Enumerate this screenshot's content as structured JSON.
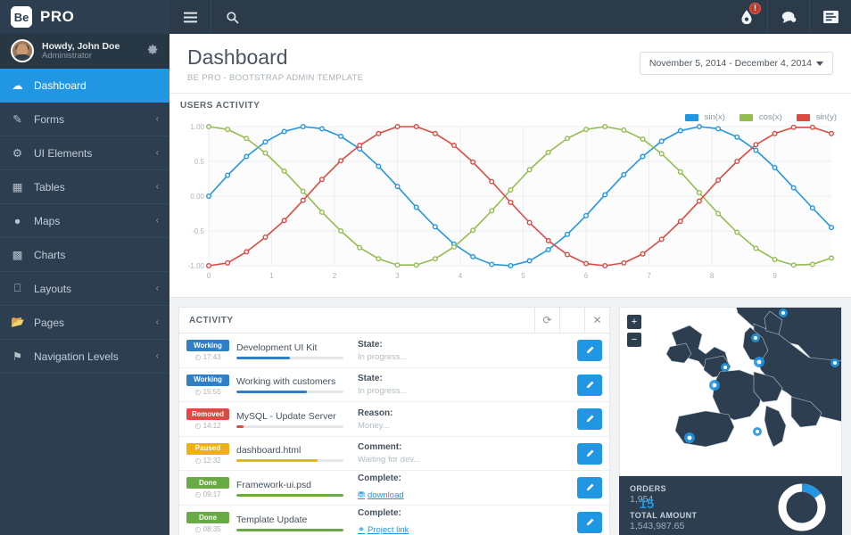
{
  "brand": {
    "mark": "Be",
    "name": "PRO"
  },
  "user": {
    "greeting": "Howdy, John Doe",
    "role": "Administrator",
    "settings_icon": "gear-icon"
  },
  "sidebar": {
    "items": [
      {
        "label": "Dashboard",
        "icon": "dashboard-icon",
        "active": true,
        "caret": ""
      },
      {
        "label": "Forms",
        "icon": "pencil-icon",
        "active": false,
        "caret": "‹"
      },
      {
        "label": "UI Elements",
        "icon": "ui-elements-icon",
        "active": false,
        "caret": "‹"
      },
      {
        "label": "Tables",
        "icon": "table-icon",
        "active": false,
        "caret": "‹"
      },
      {
        "label": "Maps",
        "icon": "map-pin-icon",
        "active": false,
        "caret": "‹"
      },
      {
        "label": "Charts",
        "icon": "bar-chart-icon",
        "active": false,
        "caret": ""
      },
      {
        "label": "Layouts",
        "icon": "monitor-icon",
        "active": false,
        "caret": "‹"
      },
      {
        "label": "Pages",
        "icon": "folder-icon",
        "active": false,
        "caret": "‹"
      },
      {
        "label": "Navigation Levels",
        "icon": "flag-icon",
        "active": false,
        "caret": "‹"
      }
    ]
  },
  "topbar": {
    "menu_icon": "hamburger-icon",
    "search_icon": "search-icon",
    "alerts_icon": "droplet-icon",
    "alerts_badge": "!",
    "messages_icon": "chat-bubble-icon",
    "tasks_icon": "list-icon"
  },
  "header": {
    "title": "Dashboard",
    "subtitle": "BE PRO - BOOTSTRAP ADMIN TEMPLATE",
    "daterange": "November 5, 2014 - December 4, 2014"
  },
  "chart_panel": {
    "caption": "USERS ACTIVITY"
  },
  "chart_data": {
    "type": "line",
    "title": "USERS ACTIVITY",
    "xlabel": "",
    "ylabel": "",
    "xlim": [
      0,
      9.9
    ],
    "ylim": [
      -1.0,
      1.0
    ],
    "grid": true,
    "legend_position": "top-right",
    "xticks": [
      "0",
      "1",
      "2",
      "3",
      "4",
      "5",
      "6",
      "7",
      "8",
      "9"
    ],
    "yticks": [
      "1.00",
      "0.5",
      "0.00",
      "-0.5",
      "-1.00"
    ],
    "x": [
      0,
      0.3,
      0.6,
      0.9,
      1.2,
      1.5,
      1.8,
      2.1,
      2.4,
      2.7,
      3.0,
      3.3,
      3.6,
      3.9,
      4.2,
      4.5,
      4.8,
      5.1,
      5.4,
      5.7,
      6.0,
      6.3,
      6.6,
      6.9,
      7.2,
      7.5,
      7.8,
      8.1,
      8.4,
      8.7,
      9.0,
      9.3,
      9.6,
      9.9
    ],
    "series": [
      {
        "name": "sin(x)",
        "color": "#2196e3",
        "values": [
          0.0,
          0.3,
          0.57,
          0.78,
          0.93,
          1.0,
          0.97,
          0.86,
          0.68,
          0.43,
          0.14,
          -0.16,
          -0.44,
          -0.69,
          -0.87,
          -0.98,
          -1.0,
          -0.93,
          -0.77,
          -0.55,
          -0.28,
          0.02,
          0.31,
          0.57,
          0.79,
          0.94,
          1.0,
          0.97,
          0.85,
          0.66,
          0.41,
          0.12,
          -0.17,
          -0.45
        ]
      },
      {
        "name": "cos(x)",
        "color": "#94bd4f",
        "values": [
          1.0,
          0.96,
          0.83,
          0.62,
          0.36,
          0.07,
          -0.23,
          -0.5,
          -0.74,
          -0.9,
          -0.99,
          -0.99,
          -0.9,
          -0.73,
          -0.49,
          -0.21,
          0.09,
          0.38,
          0.63,
          0.83,
          0.96,
          1.0,
          0.95,
          0.82,
          0.61,
          0.35,
          0.05,
          -0.25,
          -0.52,
          -0.75,
          -0.91,
          -0.99,
          -0.98,
          -0.89
        ]
      },
      {
        "name": "sin(y)",
        "color": "#dc4a42",
        "values": [
          -1.0,
          -0.96,
          -0.8,
          -0.59,
          -0.35,
          -0.06,
          0.24,
          0.51,
          0.73,
          0.9,
          1.0,
          1.0,
          0.9,
          0.73,
          0.49,
          0.21,
          -0.09,
          -0.38,
          -0.64,
          -0.84,
          -0.97,
          -1.0,
          -0.96,
          -0.83,
          -0.62,
          -0.36,
          -0.07,
          0.23,
          0.5,
          0.74,
          0.9,
          0.99,
          0.99,
          0.9
        ]
      }
    ]
  },
  "activity": {
    "title": "ACTIVITY",
    "tools": [
      {
        "icon": "refresh-icon",
        "glyph": "⟳"
      },
      {
        "icon": "chevron-down-icon",
        "glyph": "ⱟ"
      },
      {
        "icon": "close-icon",
        "glyph": "✕"
      }
    ],
    "rows": [
      {
        "status": "Working",
        "status_color": "#2f7fc6",
        "time": "17:43",
        "task": "Development UI Kit",
        "progress": 50,
        "bar_color": "#2f7fc6",
        "note_label": "State:",
        "note_value": "In progress...",
        "link": "",
        "link_icon": ""
      },
      {
        "status": "Working",
        "status_color": "#2f7fc6",
        "time": "15:55",
        "task": "Working with customers",
        "progress": 66,
        "bar_color": "#2f7fc6",
        "note_label": "State:",
        "note_value": "In progress...",
        "link": "",
        "link_icon": ""
      },
      {
        "status": "Removed",
        "status_color": "#dc4a42",
        "time": "14:12",
        "task": "MySQL - Update Server",
        "progress": 7,
        "bar_color": "#dc4a42",
        "note_label": "Reason:",
        "note_value": "Money...",
        "link": "",
        "link_icon": ""
      },
      {
        "status": "Paused",
        "status_color": "#eeb012",
        "time": "12:32",
        "task": "dashboard.html",
        "progress": 76,
        "bar_color": "#eeb012",
        "note_label": "Comment:",
        "note_value": "Waiting for dev...",
        "link": "",
        "link_icon": ""
      },
      {
        "status": "Done",
        "status_color": "#68ab45",
        "time": "09:17",
        "task": "Framework-ui.psd",
        "progress": 100,
        "bar_color": "#68ab45",
        "note_label": "Complete:",
        "note_value": "",
        "link": "download",
        "link_icon": "save-icon"
      },
      {
        "status": "Done",
        "status_color": "#68ab45",
        "time": "08:35",
        "task": "Template Update",
        "progress": 100,
        "bar_color": "#68ab45",
        "note_label": "Complete:",
        "note_value": "",
        "link": "Project link",
        "link_icon": "link-icon"
      }
    ],
    "edit_icon": "pencil-icon"
  },
  "map": {
    "zoom_in": "+",
    "zoom_out": "−",
    "zoom_in_icon": "plus-icon",
    "zoom_out_icon": "minus-icon",
    "region": "europe-vector-map"
  },
  "stats": {
    "orders_label": "ORDERS",
    "orders_value": "1,954",
    "amount_label": "TOTAL AMOUNT",
    "amount_value": "1,543,987.65",
    "donut_value": "15",
    "donut_percent": 15,
    "donut_color": "#2196e3",
    "donut_track": "#ffffff"
  },
  "colors": {
    "sidebar_bg": "#2c3e50",
    "accent": "#2196e3",
    "topbar_bg": "#2b3b4a",
    "page_bg": "#f2f3f5"
  }
}
